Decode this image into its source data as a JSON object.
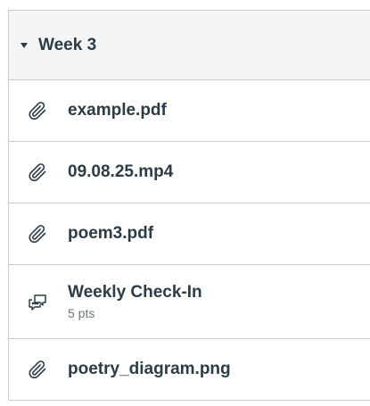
{
  "module": {
    "title": "Week 3",
    "items": [
      {
        "title": "example.pdf",
        "icon": "paperclip-icon"
      },
      {
        "title": "09.08.25.mp4",
        "icon": "paperclip-icon"
      },
      {
        "title": "poem3.pdf",
        "icon": "paperclip-icon"
      },
      {
        "title": "Weekly Check-In",
        "subtitle": "5 pts",
        "icon": "discussion-icon"
      },
      {
        "title": "poetry_diagram.png",
        "icon": "paperclip-icon"
      }
    ]
  }
}
